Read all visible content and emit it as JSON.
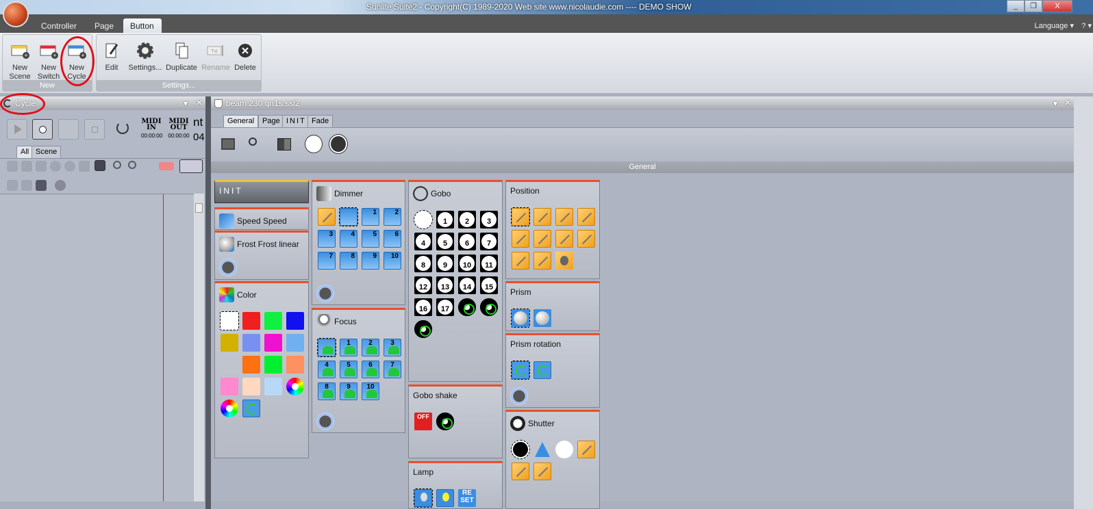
{
  "window": {
    "title": "Sunlite Suite2 - Copyright(C) 1989-2020    Web site www.nicolaudie.com ---- DEMO SHOW",
    "controls": [
      "_",
      "❐",
      "X"
    ]
  },
  "ribbon": {
    "tabs": [
      {
        "label": "Controller",
        "selected": false
      },
      {
        "label": "Page",
        "selected": false
      },
      {
        "label": "Button",
        "selected": true
      }
    ],
    "language_label": "Language ▾",
    "help_label": "? ▾",
    "groups": [
      {
        "label": "New",
        "buttons": [
          {
            "label": "New Scene",
            "icon": "new-scene-icon",
            "color": "#f2c94c"
          },
          {
            "label": "New Switch",
            "icon": "new-switch-icon",
            "color": "#e03030"
          },
          {
            "label": "New Cycle",
            "icon": "new-cycle-icon",
            "color": "#3a8ee0"
          }
        ]
      },
      {
        "label": "Settings...",
        "buttons": [
          {
            "label": "Edit",
            "icon": "edit-icon"
          },
          {
            "label": "Settings...",
            "icon": "gear-icon"
          },
          {
            "label": "Duplicate",
            "icon": "duplicate-icon"
          },
          {
            "label": "Rename",
            "icon": "rename-icon",
            "disabled": true
          },
          {
            "label": "Delete",
            "icon": "delete-icon"
          }
        ]
      }
    ]
  },
  "cycle_panel": {
    "title": "Cycle",
    "midi_in": {
      "label": "MIDI IN",
      "time": "00:00:00"
    },
    "midi_out": {
      "label": "MIDI OUT",
      "time": "00:00:00"
    },
    "clipped_text_1": "nt",
    "clipped_text_2": "04",
    "tabs": [
      {
        "label": "All",
        "selected": true
      },
      {
        "label": "Scene",
        "selected": false
      }
    ]
  },
  "main_panel": {
    "title": "beam 230 qn1s.ssl2",
    "tabs": [
      {
        "label": "General",
        "selected": true
      },
      {
        "label": "Page",
        "selected": false
      },
      {
        "label": "INIT",
        "selected": false
      },
      {
        "label": "Fade",
        "selected": false
      }
    ],
    "section_header": "General",
    "init_label": "INIT",
    "palettes": [
      {
        "name": "Speed Speed",
        "buttons": []
      },
      {
        "name": "Frost Frost linear",
        "buttons": [],
        "knob": true
      },
      {
        "name": "Color",
        "knob": false,
        "buttons": [
          {
            "t": "sel",
            "color": "#ffffff"
          },
          {
            "t": "color",
            "color": "#f02020"
          },
          {
            "t": "color",
            "color": "#10f040"
          },
          {
            "t": "color",
            "color": "#1010f0"
          },
          {
            "t": "color",
            "color": "#d4b000"
          },
          {
            "t": "color",
            "color": "#7890f0"
          },
          {
            "t": "color",
            "color": "#f010d0"
          },
          {
            "t": "color",
            "color": "#70b0f0"
          },
          {
            "t": "color",
            "color": "#c0c4cc"
          },
          {
            "t": "color",
            "color": "#ff7010"
          },
          {
            "t": "color",
            "color": "#00f030"
          },
          {
            "t": "color",
            "color": "#ff9060"
          },
          {
            "t": "color",
            "color": "#ff88d0"
          },
          {
            "t": "color",
            "color": "#ffd8c0"
          },
          {
            "t": "color",
            "color": "#b8d8f8"
          },
          {
            "t": "rainbow"
          },
          {
            "t": "rainbow"
          },
          {
            "t": "rot"
          }
        ]
      },
      {
        "name": "Dimmer",
        "knob": true,
        "buttons": [
          {
            "t": "orange"
          },
          {
            "t": "beam",
            "sel": true,
            "label": ""
          },
          {
            "t": "beam",
            "label": "1"
          },
          {
            "t": "beam",
            "label": "2"
          },
          {
            "t": "beam",
            "label": "3"
          },
          {
            "t": "beam",
            "label": "4"
          },
          {
            "t": "beam",
            "label": "5"
          },
          {
            "t": "beam",
            "label": "6"
          },
          {
            "t": "beam",
            "label": "7"
          },
          {
            "t": "beam",
            "label": "8"
          },
          {
            "t": "beam",
            "label": "9"
          },
          {
            "t": "beam",
            "label": "10"
          }
        ]
      },
      {
        "name": "Focus",
        "knob": true,
        "buttons": [
          {
            "t": "focus",
            "sel": true,
            "label": ""
          },
          {
            "t": "focus",
            "label": "1"
          },
          {
            "t": "focus",
            "label": "2"
          },
          {
            "t": "focus",
            "label": "3"
          },
          {
            "t": "focus",
            "label": "4"
          },
          {
            "t": "focus",
            "label": "5"
          },
          {
            "t": "focus",
            "label": "6"
          },
          {
            "t": "focus",
            "label": "7"
          },
          {
            "t": "focus",
            "label": "8"
          },
          {
            "t": "focus",
            "label": "9"
          },
          {
            "t": "focus",
            "label": "10"
          }
        ]
      },
      {
        "name": "Gobo",
        "knob": false,
        "buttons": [
          {
            "t": "circle-w",
            "sel": true
          },
          {
            "t": "gobo",
            "label": "1"
          },
          {
            "t": "gobo",
            "label": "2"
          },
          {
            "t": "gobo",
            "label": "3"
          },
          {
            "t": "gobo",
            "label": "4"
          },
          {
            "t": "gobo",
            "label": "5"
          },
          {
            "t": "gobo",
            "label": "6"
          },
          {
            "t": "gobo",
            "label": "7"
          },
          {
            "t": "gobo",
            "label": "8"
          },
          {
            "t": "gobo",
            "label": "9"
          },
          {
            "t": "gobo",
            "label": "10"
          },
          {
            "t": "gobo",
            "label": "11"
          },
          {
            "t": "gobo",
            "label": "12"
          },
          {
            "t": "gobo",
            "label": "13"
          },
          {
            "t": "gobo",
            "label": "14"
          },
          {
            "t": "gobo",
            "label": "15"
          },
          {
            "t": "gobo",
            "label": "16"
          },
          {
            "t": "gobo",
            "label": "17"
          },
          {
            "t": "wheel"
          },
          {
            "t": "wheel"
          },
          {
            "t": "wheel"
          }
        ]
      },
      {
        "name": "Gobo shake",
        "knob": false,
        "buttons": [
          {
            "t": "off",
            "label": "OFF"
          },
          {
            "t": "wheel"
          }
        ]
      },
      {
        "name": "Lamp",
        "knob": false,
        "buttons": [
          {
            "t": "bulb",
            "sel": true
          },
          {
            "t": "bulb on"
          },
          {
            "t": "reset",
            "label": "RE SET"
          }
        ]
      },
      {
        "name": "Position",
        "knob": false,
        "buttons": [
          {
            "t": "orange",
            "sel": true
          },
          {
            "t": "orange"
          },
          {
            "t": "orange"
          },
          {
            "t": "orange"
          },
          {
            "t": "orange"
          },
          {
            "t": "orange"
          },
          {
            "t": "orange"
          },
          {
            "t": "orange"
          },
          {
            "t": "orange"
          },
          {
            "t": "orange"
          },
          {
            "t": "speaker"
          }
        ]
      },
      {
        "name": "Prism",
        "knob": false,
        "buttons": [
          {
            "t": "prism",
            "sel": true
          },
          {
            "t": "prism"
          }
        ]
      },
      {
        "name": "Prism rotation",
        "knob": true,
        "buttons": [
          {
            "t": "rot",
            "sel": true
          },
          {
            "t": "rot"
          }
        ]
      },
      {
        "name": "Shutter",
        "knob": false,
        "buttons": [
          {
            "t": "circle-b",
            "sel": true
          },
          {
            "t": "tri"
          },
          {
            "t": "circle-w"
          },
          {
            "t": "orange"
          },
          {
            "t": "orange"
          },
          {
            "t": "orange"
          }
        ]
      }
    ]
  }
}
